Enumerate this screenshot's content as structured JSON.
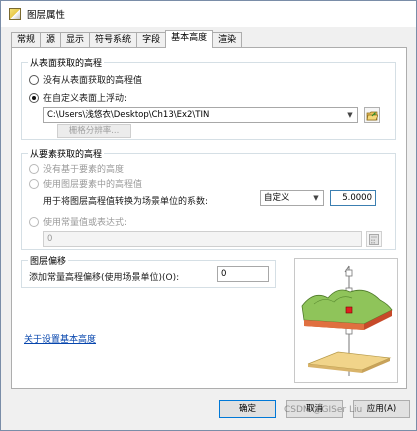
{
  "window": {
    "title": "图层属性"
  },
  "tabs": [
    {
      "label": "常规"
    },
    {
      "label": "源"
    },
    {
      "label": "显示"
    },
    {
      "label": "符号系统"
    },
    {
      "label": "字段"
    },
    {
      "label": "基本高度"
    },
    {
      "label": "渲染"
    }
  ],
  "surface_group": {
    "legend": "从表面获取的高程",
    "option_none": "没有从表面获取的高程值",
    "option_custom": "在自定义表面上浮动:",
    "surface_path": "C:\\Users\\浅悠衣\\Desktop\\Ch13\\Ex2\\TIN",
    "raster_resolution_button": "栅格分辨率..."
  },
  "feature_group": {
    "legend": "从要素获取的高程",
    "option_no_feature_height": "没有基于要素的高度",
    "option_use_feature_z": "使用图层要素中的高程值",
    "conversion_label": "用于将图层高程值转换为场景单位的系数:",
    "unit_select": "自定义",
    "factor_value": "5.0000",
    "option_constant": "使用常量值或表达式:",
    "constant_value": "0"
  },
  "offset_group": {
    "legend": "图层偏移",
    "label": "添加常量高程偏移(使用场景单位)(O):",
    "value": "0"
  },
  "help_link": "关于设置基本高度",
  "footer": {
    "ok": "确定",
    "cancel": "取消",
    "apply": "应用(A)"
  },
  "watermark": "CSDN @GISer Liu",
  "colors": {
    "selected_accent": "#0078d7",
    "link": "#0645ad",
    "terrain_green": "#7bb24a",
    "terrain_red": "#d43c2a",
    "base_plane": "#e8c77d"
  }
}
